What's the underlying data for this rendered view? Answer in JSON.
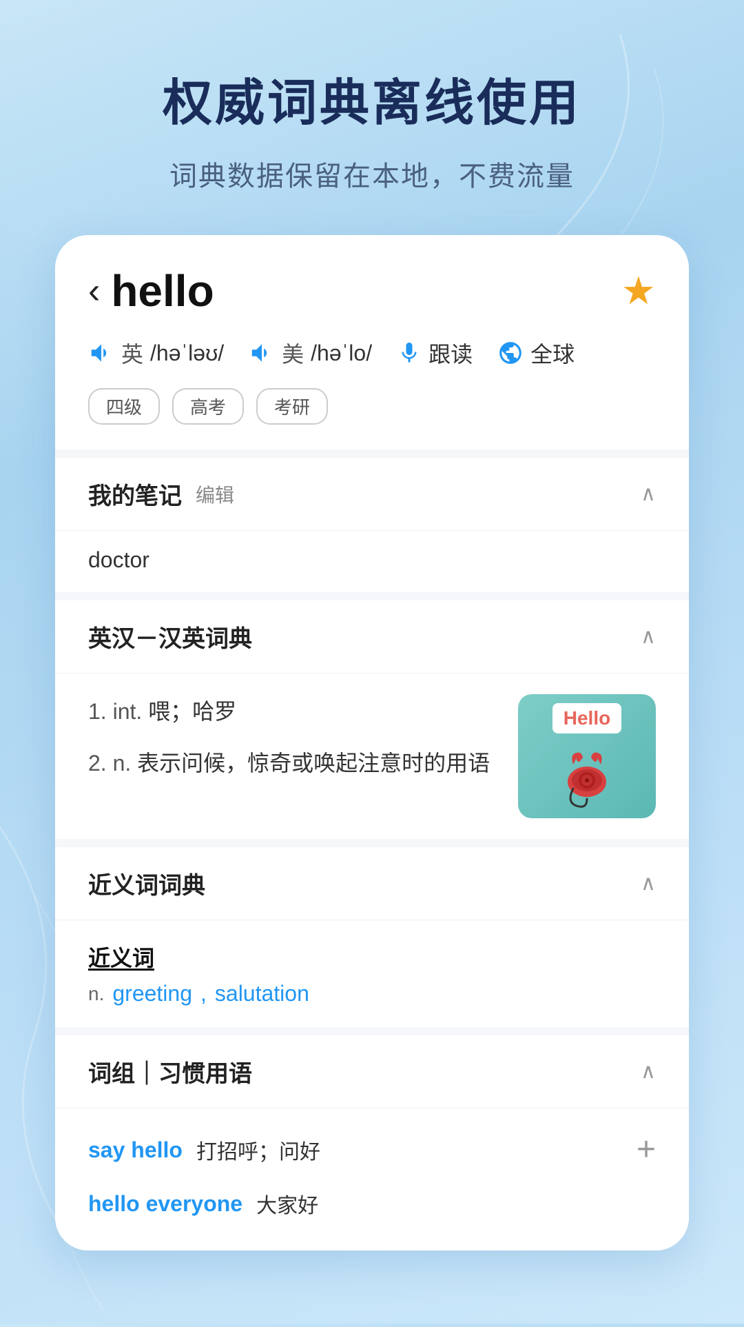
{
  "background": {
    "gradient_start": "#c8e6f7",
    "gradient_end": "#a8d4f0"
  },
  "hero": {
    "title": "权威词典离线使用",
    "subtitle": "词典数据保留在本地，不费流量"
  },
  "word_card": {
    "back_arrow": "‹",
    "word": "hello",
    "star_filled": true,
    "pronunciations": [
      {
        "flag": "英",
        "phonetic": "/həˈləʊ/"
      },
      {
        "flag": "美",
        "phonetic": "/həˈlo/"
      }
    ],
    "follow_read_label": "跟读",
    "global_label": "全球",
    "tags": [
      "四级",
      "高考",
      "考研"
    ]
  },
  "notes_section": {
    "title": "我的笔记",
    "edit_label": "编辑",
    "content": "doctor",
    "collapsed": false
  },
  "en_cn_section": {
    "title": "英汉－汉英词典",
    "collapsed": false,
    "definitions": [
      {
        "num": "1.",
        "pos": "int.",
        "meaning": "喂；哈罗"
      },
      {
        "num": "2.",
        "pos": "n.",
        "meaning": "表示问候，惊奇或唤起注意时的用语"
      }
    ],
    "image_alt": "Hello telephone illustration"
  },
  "synonyms_section": {
    "title": "近义词词典",
    "collapsed": false,
    "subtitle": "近义词",
    "pos": "n.",
    "synonyms": [
      "greeting",
      "salutation"
    ]
  },
  "phrases_section": {
    "title": "词组｜习惯用语",
    "collapsed": false,
    "phrases": [
      {
        "en": "say hello",
        "zh": "打招呼；问好"
      },
      {
        "en": "hello everyone",
        "zh": "大家好"
      }
    ]
  }
}
